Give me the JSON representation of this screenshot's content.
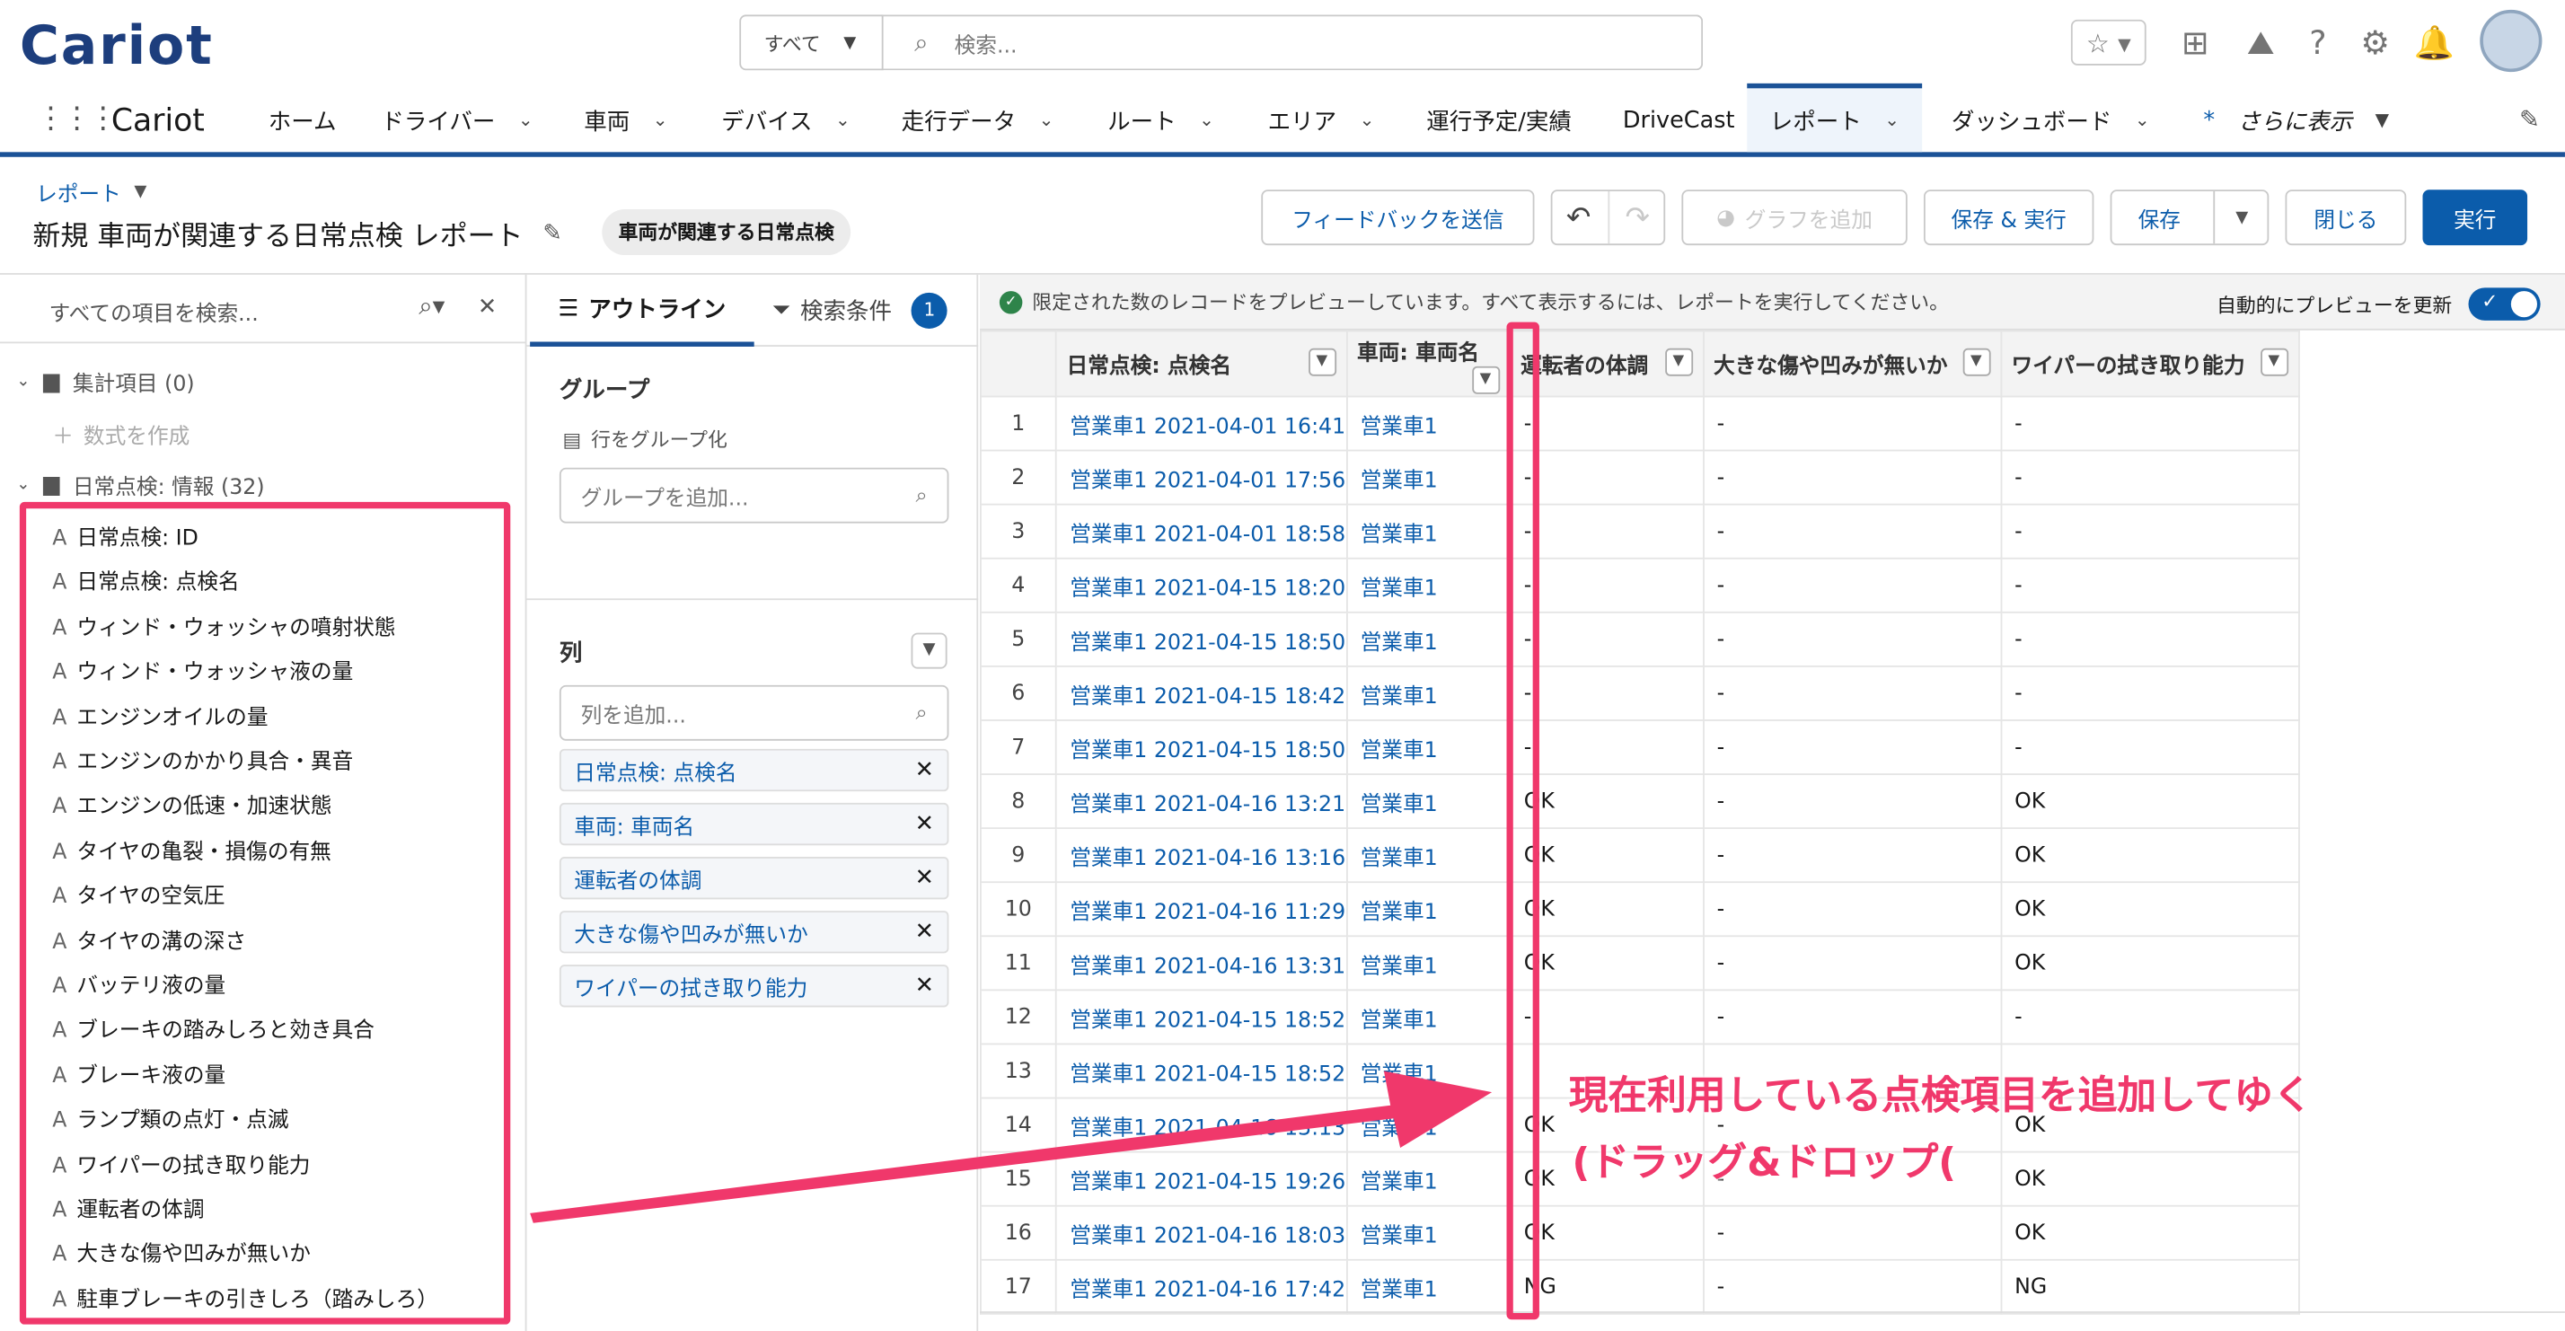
{
  "header": {
    "logo": "Cariot",
    "scope": "すべて",
    "search_placeholder": "検索..."
  },
  "nav": {
    "app": "Cariot",
    "items": [
      "ホーム",
      "ドライバー",
      "車両",
      "デバイス",
      "走行データ",
      "ルート",
      "エリア",
      "運行予定/実績",
      "DriveCast",
      "レポート",
      "ダッシュボード",
      "さらに表示"
    ]
  },
  "report": {
    "breadcrumb": "レポート",
    "title": "新規 車両が関連する日常点検 レポート",
    "badge": "車両が関連する日常点検"
  },
  "toolbar": {
    "feedback": "フィードバックを送信",
    "add_chart": "グラフを追加",
    "save_run": "保存 & 実行",
    "save": "保存",
    "close": "閉じる",
    "run": "実行"
  },
  "fields": {
    "search_placeholder": "すべての項目を検索...",
    "group1": "集計項目 (0)",
    "create_formula": "数式を作成",
    "group2": "日常点検: 情報 (32)",
    "items": [
      "日常点検: ID",
      "日常点検: 点検名",
      "ウィンド・ウォッシャの噴射状態",
      "ウィンド・ウォッシャ液の量",
      "エンジンオイルの量",
      "エンジンのかかり具合・異音",
      "エンジンの低速・加速状態",
      "タイヤの亀裂・損傷の有無",
      "タイヤの空気圧",
      "タイヤの溝の深さ",
      "バッテリ液の量",
      "ブレーキの踏みしろと効き具合",
      "ブレーキ液の量",
      "ランプ類の点灯・点滅",
      "ワイパーの拭き取り能力",
      "運転者の体調",
      "大きな傷や凹みが無いか",
      "駐車ブレーキの引きしろ（踏みしろ）"
    ]
  },
  "outline": {
    "tab_outline": "アウトライン",
    "tab_filter": "検索条件",
    "filter_count": "1",
    "groups_title": "グループ",
    "group_rows": "行をグループ化",
    "group_placeholder": "グループを追加...",
    "columns_title": "列",
    "column_placeholder": "列を追加...",
    "columns": [
      "日常点検: 点検名",
      "車両: 車両名",
      "運転者の体調",
      "大きな傷や凹みが無いか",
      "ワイパーの拭き取り能力"
    ]
  },
  "preview": {
    "notice": "限定された数のレコードをプレビューしています。すべて表示するには、レポートを実行してください。",
    "auto_update": "自動的にプレビューを更新"
  },
  "table": {
    "headers": [
      "日常点検: 点検名",
      "車両: 車両名",
      "運転者の体調",
      "大きな傷や凹みが無いか",
      "ワイパーの拭き取り能力"
    ],
    "rows": [
      [
        "1",
        "営業車1 2021-04-01 16:41",
        "営業車1",
        "-",
        "-",
        "-"
      ],
      [
        "2",
        "営業車1 2021-04-01 17:56",
        "営業車1",
        "-",
        "-",
        "-"
      ],
      [
        "3",
        "営業車1 2021-04-01 18:58",
        "営業車1",
        "-",
        "-",
        "-"
      ],
      [
        "4",
        "営業車1 2021-04-15 18:20",
        "営業車1",
        "-",
        "-",
        "-"
      ],
      [
        "5",
        "営業車1 2021-04-15 18:50",
        "営業車1",
        "-",
        "-",
        "-"
      ],
      [
        "6",
        "営業車1 2021-04-15 18:42",
        "営業車1",
        "-",
        "-",
        "-"
      ],
      [
        "7",
        "営業車1 2021-04-15 18:50",
        "営業車1",
        "-",
        "-",
        "-"
      ],
      [
        "8",
        "営業車1 2021-04-16 13:21",
        "営業車1",
        "OK",
        "-",
        "OK"
      ],
      [
        "9",
        "営業車1 2021-04-16 13:16",
        "営業車1",
        "OK",
        "-",
        "OK"
      ],
      [
        "10",
        "営業車1 2021-04-16 11:29",
        "営業車1",
        "OK",
        "-",
        "OK"
      ],
      [
        "11",
        "営業車1 2021-04-16 13:31",
        "営業車1",
        "OK",
        "-",
        "OK"
      ],
      [
        "12",
        "営業車1 2021-04-15 18:52",
        "営業車1",
        "-",
        "-",
        "-"
      ],
      [
        "13",
        "営業車1 2021-04-15 18:52",
        "営業車1",
        "",
        "",
        ""
      ],
      [
        "14",
        "営業車1 2021-04-16 13:13",
        "営業車1",
        "OK",
        "-",
        "OK"
      ],
      [
        "15",
        "営業車1 2021-04-15 19:26",
        "営業車1",
        "OK",
        "-",
        "OK"
      ],
      [
        "16",
        "営業車1 2021-04-16 18:03",
        "営業車1",
        "OK",
        "-",
        "OK"
      ],
      [
        "17",
        "営業車1 2021-04-16 17:42",
        "営業車1",
        "NG",
        "-",
        "NG"
      ]
    ]
  },
  "annotation": {
    "line1": "現在利用している点検項目を追加してゆく",
    "line2": "(ドラッグ&ドロップ(",
    "color": "#f0386b"
  }
}
